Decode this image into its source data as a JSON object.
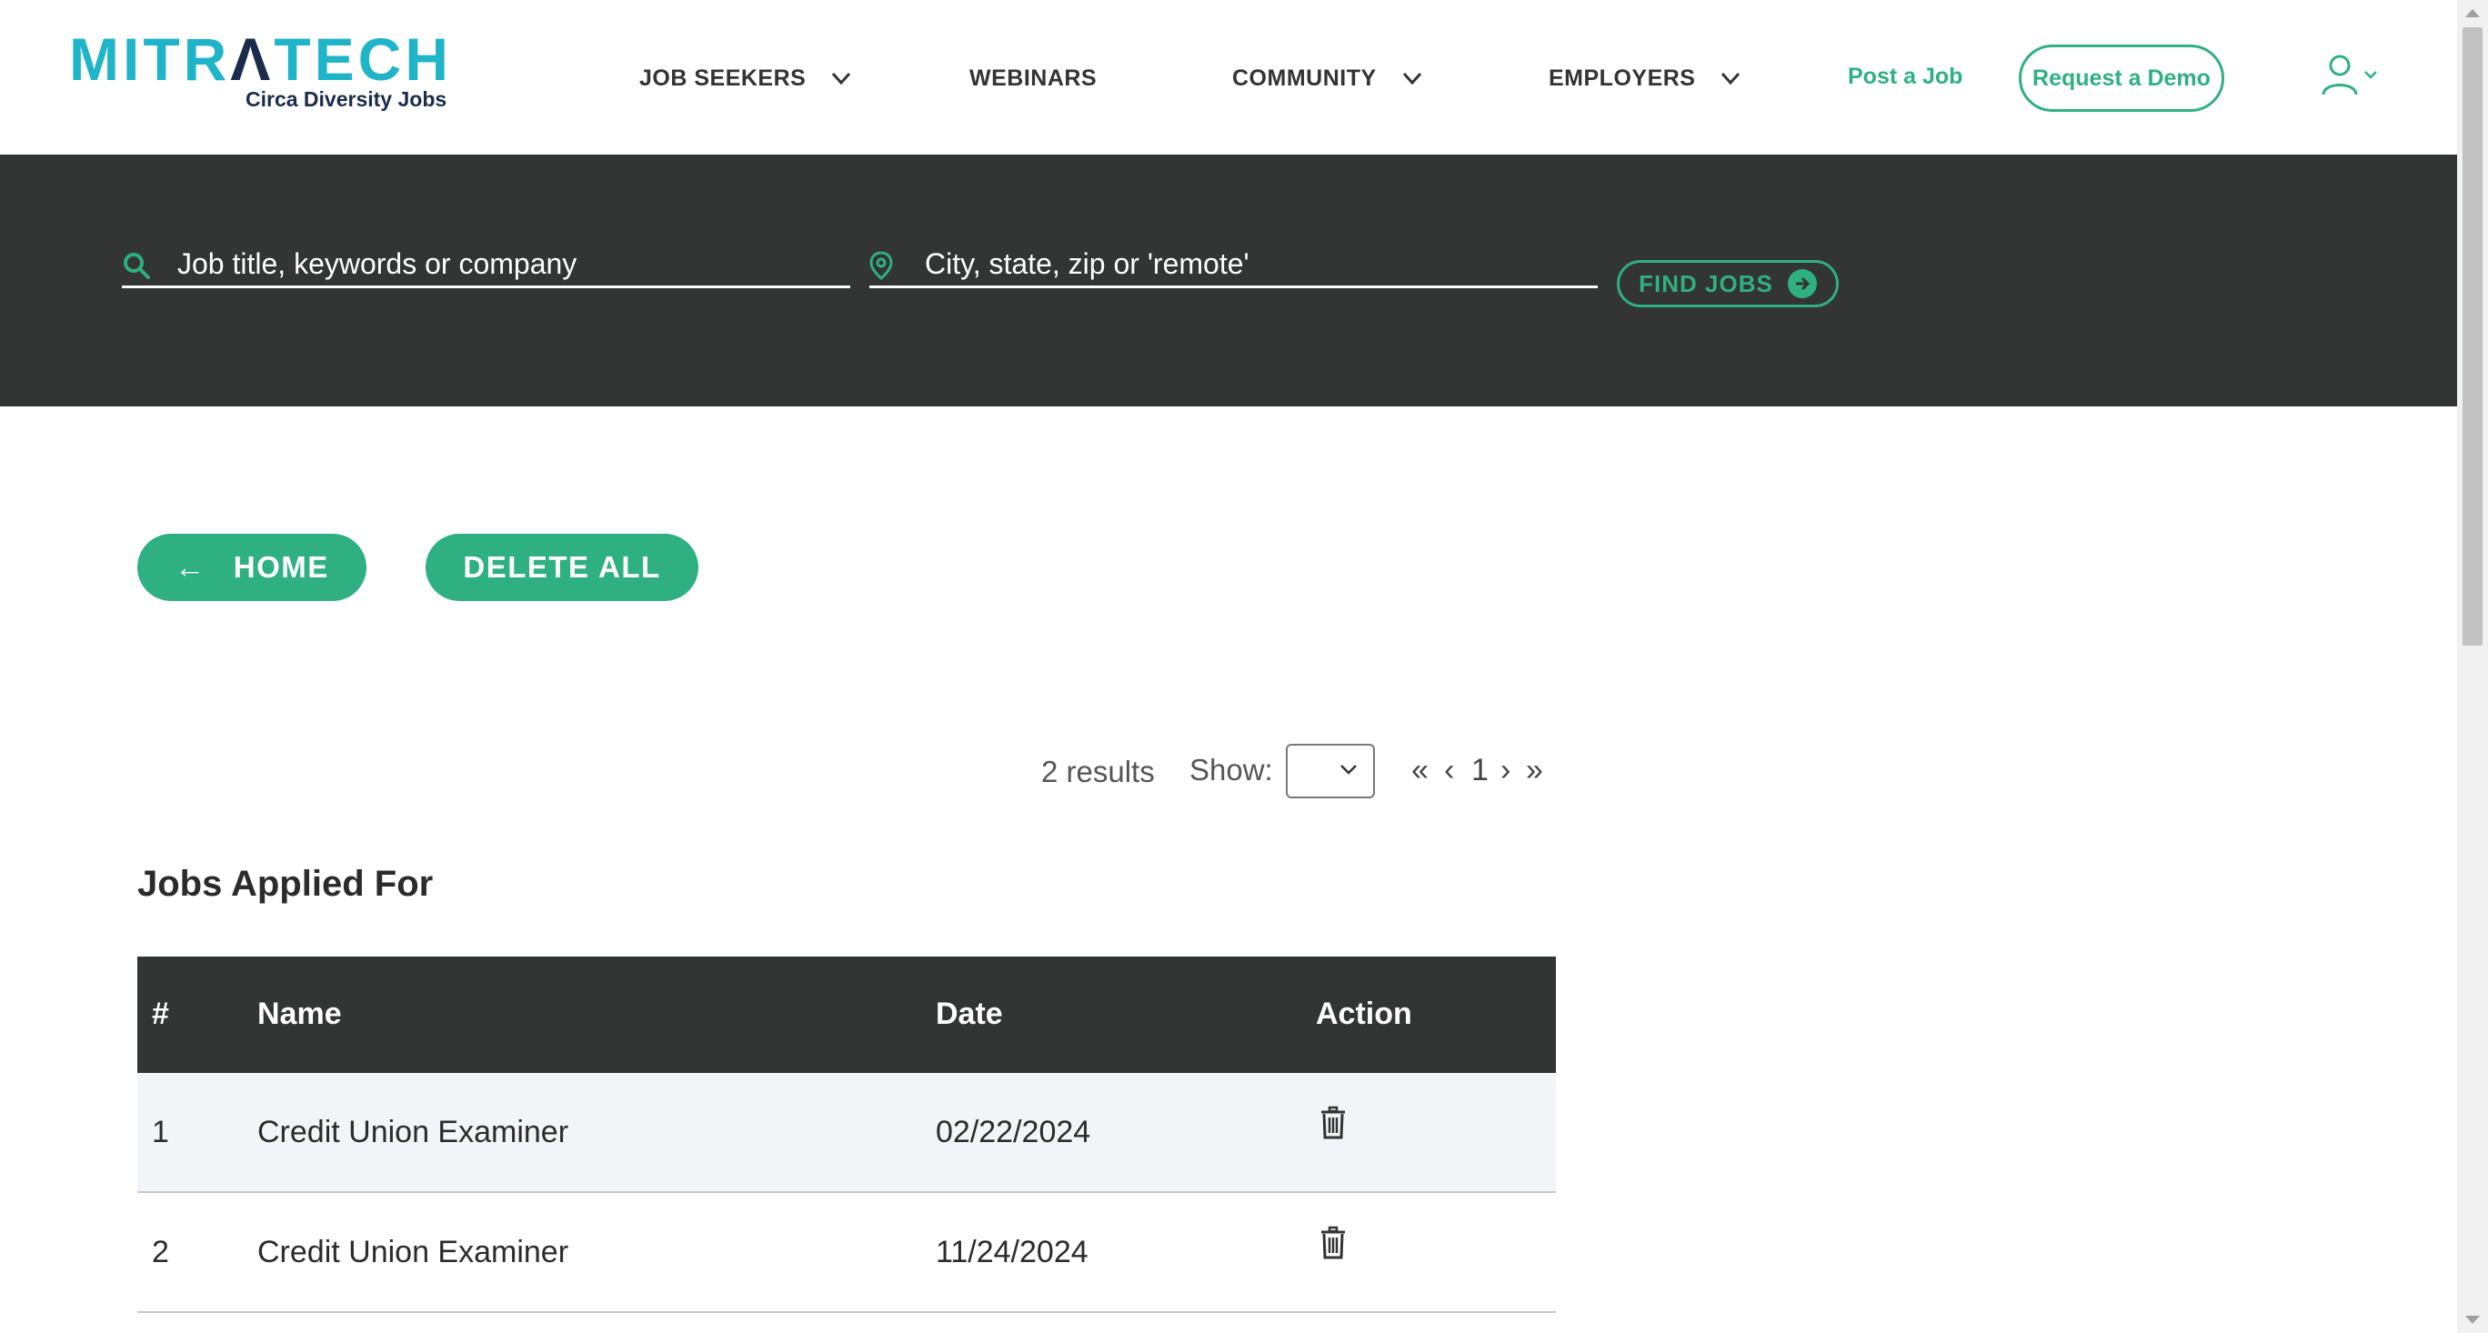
{
  "brand": {
    "logo_prefix": "MITR",
    "logo_mark": "Λ",
    "logo_suffix": "TECH",
    "tagline": "Circa Diversity Jobs",
    "primary_color": "#2fb082",
    "logo_color": "#1fb4c8",
    "dark_color": "#333434"
  },
  "nav": {
    "items": [
      {
        "label": "JOB SEEKERS",
        "has_dropdown": true
      },
      {
        "label": "WEBINARS",
        "has_dropdown": false
      },
      {
        "label": "COMMUNITY",
        "has_dropdown": true
      },
      {
        "label": "EMPLOYERS",
        "has_dropdown": true
      }
    ],
    "post_job": "Post a Job",
    "request_demo": "Request a Demo",
    "user_icon": "user-icon"
  },
  "search": {
    "keyword_placeholder": "Job title, keywords or company",
    "location_placeholder": "City, state, zip or 'remote'",
    "find_label": "FIND JOBS",
    "keyword_icon": "search-icon",
    "location_icon": "map-pin-icon"
  },
  "actions": {
    "home_arrow": "←",
    "home_label": "HOME",
    "delete_all_label": "DELETE ALL"
  },
  "results_bar": {
    "results_text": "2 results",
    "show_label": "Show:",
    "show_value": "",
    "first": "«",
    "prev": "‹",
    "page": "1",
    "next": "›",
    "last": "»"
  },
  "jobs": {
    "title": "Jobs Applied For",
    "columns": [
      "#",
      "Name",
      "Date",
      "Action"
    ],
    "rows": [
      {
        "num": "1",
        "name": "Credit Union Examiner",
        "date": "02/22/2024",
        "action_icon": "trash-icon"
      },
      {
        "num": "2",
        "name": "Credit Union Examiner",
        "date": "11/24/2024",
        "action_icon": "trash-icon"
      }
    ]
  }
}
